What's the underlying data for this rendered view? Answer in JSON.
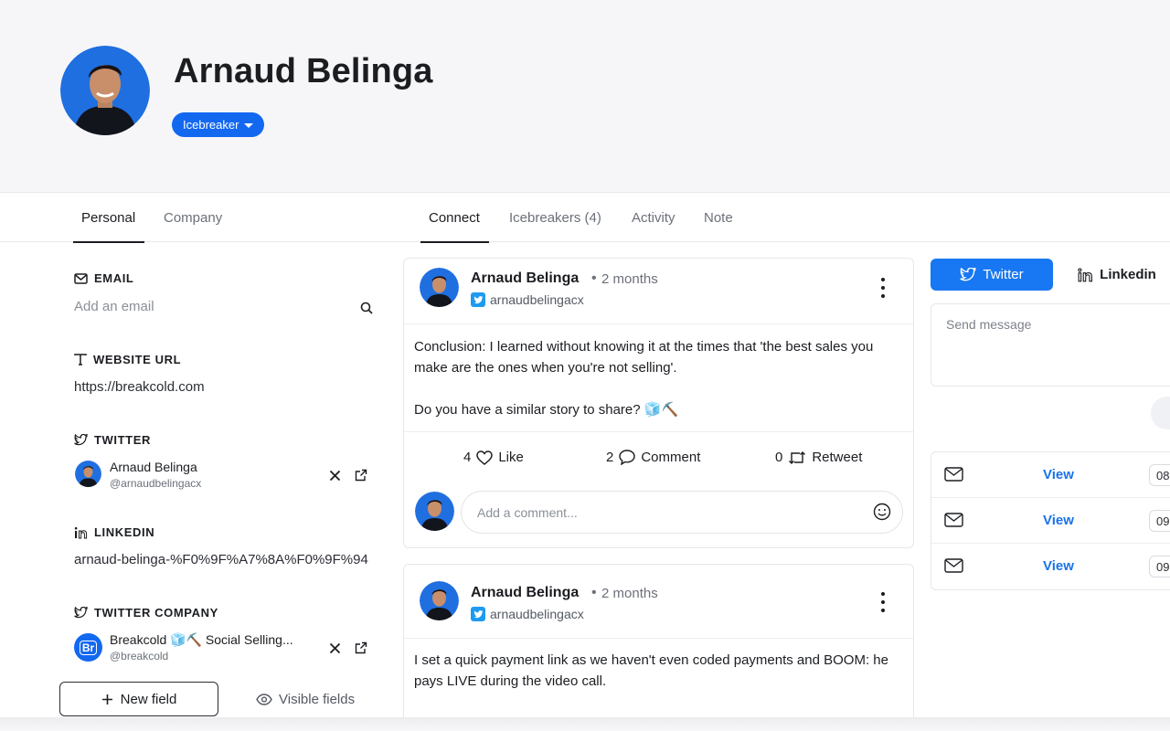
{
  "profile": {
    "name": "Arnaud Belinga",
    "stage_label": "Icebreaker"
  },
  "left_tabs": [
    {
      "label": "Personal",
      "active": true
    },
    {
      "label": "Company",
      "active": false
    }
  ],
  "center_tabs": [
    {
      "label": "Connect",
      "active": true
    },
    {
      "label": "Icebreakers (4)",
      "active": false
    },
    {
      "label": "Activity",
      "active": false
    },
    {
      "label": "Note",
      "active": false
    }
  ],
  "fields": {
    "email": {
      "label": "EMAIL",
      "placeholder": "Add an email"
    },
    "website": {
      "label": "WEBSITE URL",
      "value": "https://breakcold.com"
    },
    "twitter": {
      "label": "TWITTER",
      "name": "Arnaud Belinga",
      "handle": "@arnaudbelingacx"
    },
    "linkedin": {
      "label": "LINKEDIN",
      "value": "arnaud-belinga-%F0%9F%A7%8A%F0%9F%94"
    },
    "twitter_company": {
      "label": "TWITTER COMPANY",
      "name": "Breakcold 🧊⛏️ Social Selling...",
      "handle": "@breakcold",
      "logo_text": "Br"
    }
  },
  "footer_buttons": {
    "new_field": "New field",
    "visible_fields": "Visible fields"
  },
  "posts": [
    {
      "author": "Arnaud Belinga",
      "separator": "•",
      "time": "2 months",
      "handle": "arnaudbelingacx",
      "text": "Conclusion: I learned without knowing it at the times that 'the best sales you make are the ones when you're not selling'.\n\nDo you have a similar story to share? 🧊⛏️",
      "likes_count": "4",
      "likes_label": "Like",
      "comments_count": "2",
      "comments_label": "Comment",
      "retweets_count": "0",
      "retweets_label": "Retweet",
      "comment_placeholder": "Add a comment..."
    },
    {
      "author": "Arnaud Belinga",
      "separator": "•",
      "time": "2 months",
      "handle": "arnaudbelingacx",
      "text": "I set a quick payment link as we haven't even coded payments and BOOM: he pays LIVE during the video call."
    }
  ],
  "panel": {
    "tabs": [
      {
        "label": "Twitter",
        "active": true
      },
      {
        "label": "Linkedin",
        "active": false
      }
    ],
    "message_placeholder": "Send message",
    "messages": [
      {
        "action": "View",
        "time": "08"
      },
      {
        "action": "View",
        "time": "09"
      },
      {
        "action": "View",
        "time": "09"
      }
    ]
  },
  "colors": {
    "accent": "#1368f0",
    "twitter_blue": "#1d9bf0",
    "link_blue": "#1a73e8"
  }
}
